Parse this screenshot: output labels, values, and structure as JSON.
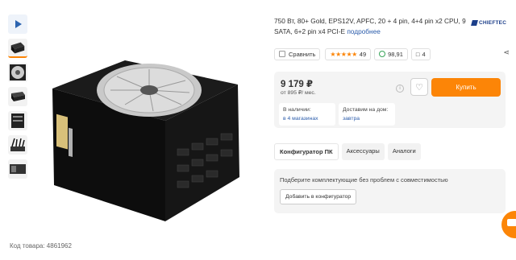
{
  "product": {
    "title": "750 Вт, 80+ Gold, EPS12V, APFC, 20 + 4 pin, 4+4 pin x2 CPU, 9 SATA, 6+2 pin x4 PCI-E",
    "details_link": "подробнее",
    "brand": "CHIEFTEC",
    "sku_label": "Код товара: 4861962"
  },
  "meta": {
    "compare_label": "Сравнить",
    "stars": "★★★★★",
    "rating_value": "4.9",
    "reviews_count": "49",
    "reliability": "98,91",
    "comments_count": "4"
  },
  "buy": {
    "price": "9 179 ₽",
    "credit": "от 895 ₽/ мес.",
    "buy_label": "Купить",
    "availability_label": "В наличии:",
    "availability_value": "в 4 магазинах",
    "delivery_label": "Доставим на дом:",
    "delivery_value": "завтра"
  },
  "tabs": [
    "Конфигуратор ПК",
    "Аксессуары",
    "Аналоги"
  ],
  "configurator": {
    "text": "Подберите комплектующие без проблем с совместимостью",
    "button_label": "Добавить в конфигуратор"
  },
  "colors": {
    "accent": "#fc8507",
    "link": "#2b5cab",
    "brand": "#1c3f8a"
  },
  "icons": [
    "play-icon",
    "heart-icon",
    "info-icon",
    "share-icon",
    "comment-icon",
    "shield-check-icon",
    "chat-icon"
  ]
}
